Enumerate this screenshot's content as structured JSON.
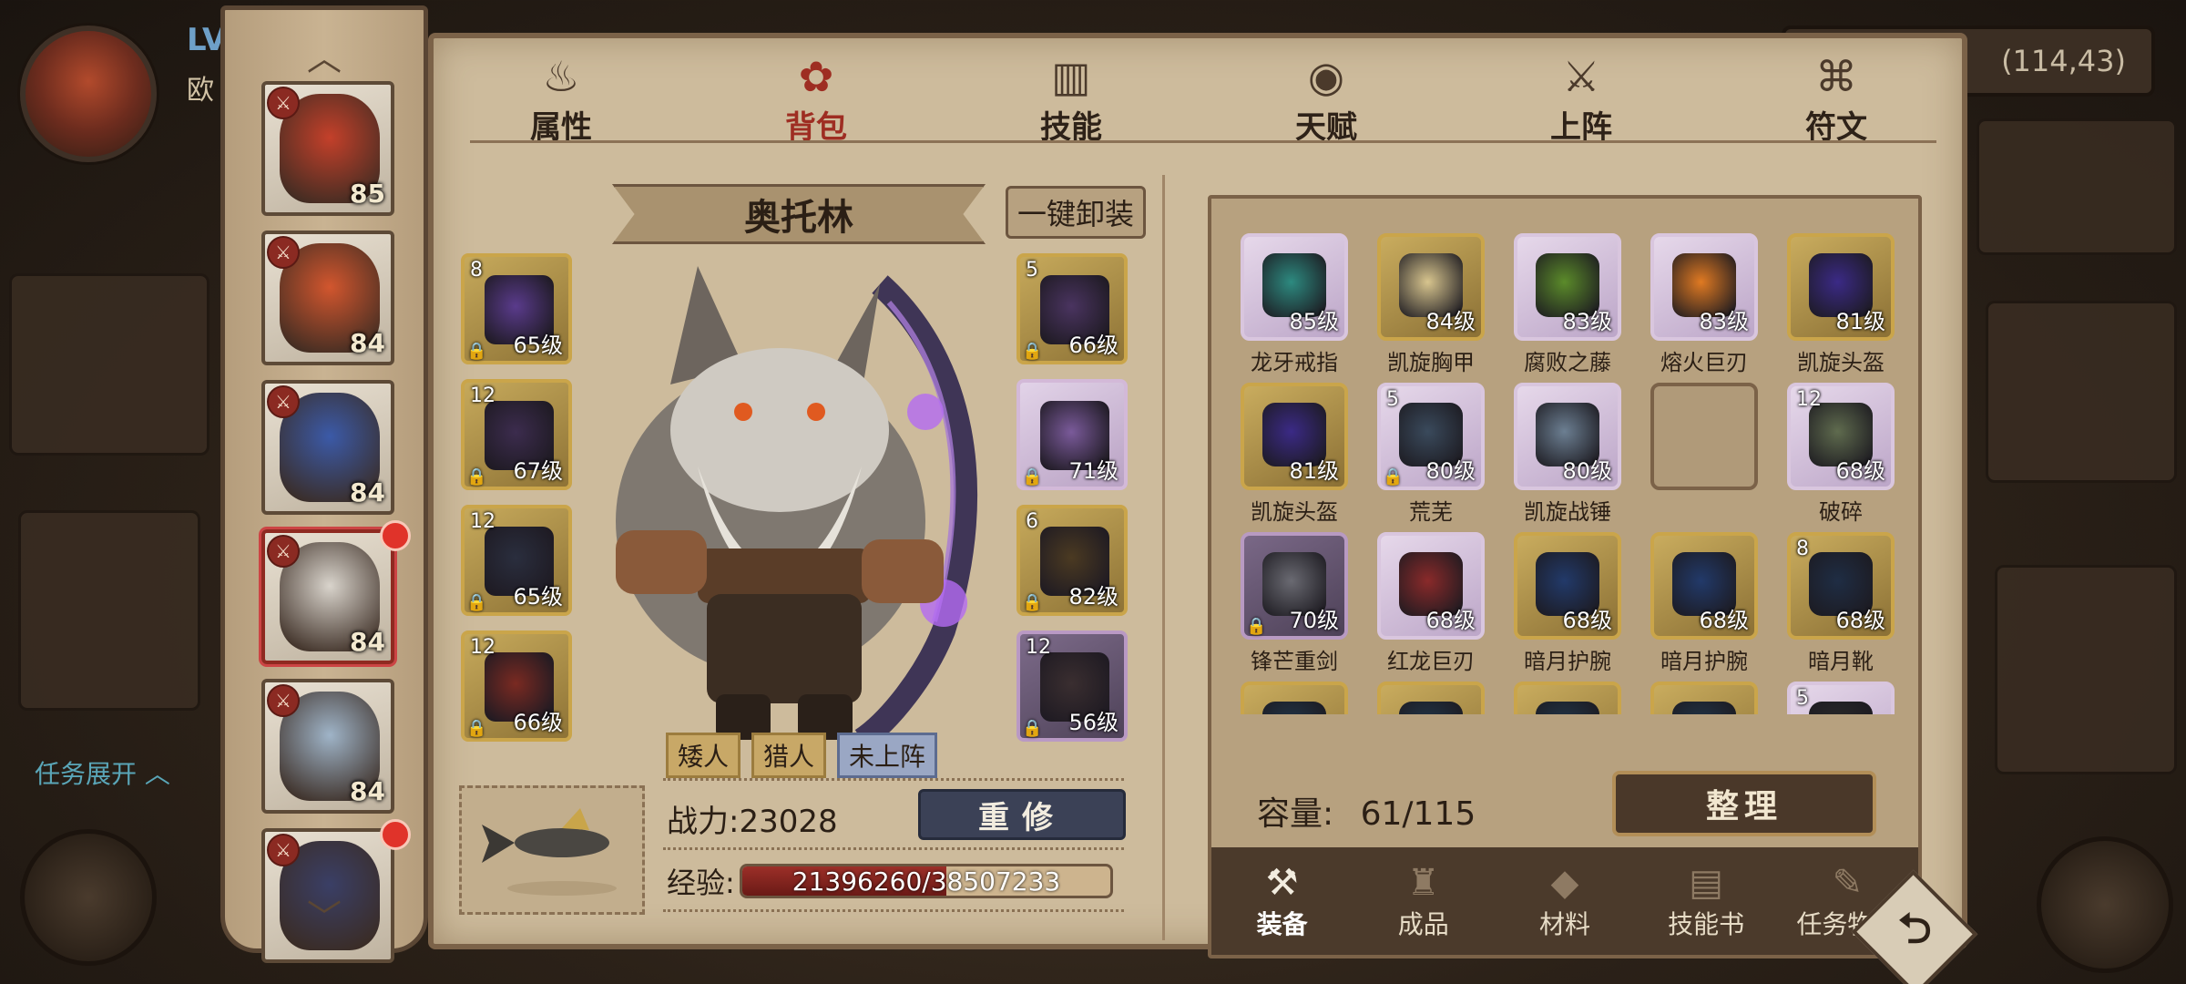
{
  "hud": {
    "level_prefix": "LV",
    "name_fragment": "欧",
    "coordinates": "(114,43)",
    "quest_toggle": "任务展开"
  },
  "roster": {
    "heroes": [
      {
        "level": "85",
        "accent": "#c4402a",
        "active": false,
        "red_dot": false
      },
      {
        "level": "84",
        "accent": "#d2562e",
        "active": false,
        "red_dot": false
      },
      {
        "level": "84",
        "accent": "#3b5aa8",
        "active": false,
        "red_dot": false
      },
      {
        "level": "84",
        "accent": "#d9d4cc",
        "active": true,
        "red_dot": true
      },
      {
        "level": "84",
        "accent": "#9fb4c8",
        "active": false,
        "red_dot": false
      },
      {
        "level": "",
        "accent": "#3a3f66",
        "active": false,
        "red_dot": true
      }
    ]
  },
  "tabs": [
    {
      "label": "属性",
      "icon": "flame-icon",
      "glyph": "♨",
      "active": false
    },
    {
      "label": "背包",
      "icon": "backpack-icon",
      "glyph": "✿",
      "active": true
    },
    {
      "label": "技能",
      "icon": "book-icon",
      "glyph": "▥",
      "active": false
    },
    {
      "label": "天赋",
      "icon": "eye-icon",
      "glyph": "◉",
      "active": false
    },
    {
      "label": "上阵",
      "icon": "crossed-swords-icon",
      "glyph": "⚔",
      "active": false
    },
    {
      "label": "符文",
      "icon": "rune-icon",
      "glyph": "⌘",
      "active": false
    }
  ],
  "hero": {
    "name": "奥托林",
    "unequip_all": "一键卸装",
    "tags": [
      "矮人",
      "猎人",
      "未上阵"
    ],
    "power": "战力:23028",
    "reforge": "重修",
    "exp_label": "经验:",
    "exp_text": "21396260/38507233",
    "exp_fraction": 0.5556
  },
  "equipment_left": [
    {
      "count": "8",
      "level": "65级",
      "rarity": "gold",
      "color": "#5a3b8c"
    },
    {
      "count": "12",
      "level": "67级",
      "rarity": "gold",
      "color": "#3c2c4e"
    },
    {
      "count": "12",
      "level": "65级",
      "rarity": "gold",
      "color": "#2a2e3e"
    },
    {
      "count": "12",
      "level": "66级",
      "rarity": "gold",
      "color": "#7a2a22"
    }
  ],
  "equipment_right": [
    {
      "count": "5",
      "level": "66级",
      "rarity": "gold",
      "color": "#4a3460"
    },
    {
      "count": "",
      "level": "71级",
      "rarity": "purple",
      "color": "#7a5a9a"
    },
    {
      "count": "6",
      "level": "82级",
      "rarity": "gold",
      "color": "#4b3a22"
    },
    {
      "count": "12",
      "level": "56级",
      "rarity": "dark",
      "color": "#3a2e30"
    }
  ],
  "inventory": {
    "capacity_label": "容量:",
    "capacity_value": "61/115",
    "sort_label": "整理",
    "items": [
      {
        "name": "龙牙戒指",
        "level": "85级",
        "count": "",
        "rarity": "purple",
        "color": "#2d8a80"
      },
      {
        "name": "凯旋胸甲",
        "level": "84级",
        "count": "",
        "rarity": "gold",
        "color": "#d8c58e"
      },
      {
        "name": "腐败之藤",
        "level": "83级",
        "count": "",
        "rarity": "purple",
        "color": "#5b8b2a"
      },
      {
        "name": "熔火巨刃",
        "level": "83级",
        "count": "",
        "rarity": "purple",
        "color": "#e07a22"
      },
      {
        "name": "凯旋头盔",
        "level": "81级",
        "count": "",
        "rarity": "gold",
        "color": "#3b2a86"
      },
      {
        "name": "凯旋头盔",
        "level": "81级",
        "count": "",
        "rarity": "gold",
        "color": "#3b2a86"
      },
      {
        "name": "荒芜",
        "level": "80级",
        "count": "5",
        "rarity": "purple",
        "color": "#3a4a5c"
      },
      {
        "name": "凯旋战锤",
        "level": "80级",
        "count": "",
        "rarity": "purple",
        "color": "#6c7f92"
      },
      {
        "name": "",
        "level": "",
        "count": "",
        "rarity": "empty",
        "color": "#b09a79"
      },
      {
        "name": "破碎",
        "level": "68级",
        "count": "12",
        "rarity": "purple",
        "color": "#5f6b4e"
      },
      {
        "name": "锋芒重剑",
        "level": "70级",
        "count": "",
        "rarity": "dark",
        "color": "#6a6a72"
      },
      {
        "name": "红龙巨刃",
        "level": "68级",
        "count": "",
        "rarity": "purple",
        "color": "#8a2a2a"
      },
      {
        "name": "暗月护腕",
        "level": "68级",
        "count": "",
        "rarity": "gold",
        "color": "#223a6a"
      },
      {
        "name": "暗月护腕",
        "level": "68级",
        "count": "",
        "rarity": "gold",
        "color": "#223a6a"
      },
      {
        "name": "暗月靴",
        "level": "68级",
        "count": "8",
        "rarity": "gold",
        "color": "#1f2d44"
      },
      {
        "name": "",
        "level": "",
        "count": "",
        "rarity": "gold",
        "color": "#22394e"
      },
      {
        "name": "",
        "level": "",
        "count": "",
        "rarity": "gold",
        "color": "#22394e"
      },
      {
        "name": "",
        "level": "",
        "count": "",
        "rarity": "gold",
        "color": "#22394e"
      },
      {
        "name": "",
        "level": "",
        "count": "",
        "rarity": "gold",
        "color": "#22394e"
      },
      {
        "name": "",
        "level": "",
        "count": "5",
        "rarity": "purple",
        "color": "#2b2b2b"
      }
    ],
    "tabs": [
      {
        "label": "装备",
        "icon": "hammer-icon",
        "glyph": "⚒",
        "active": true
      },
      {
        "label": "成品",
        "icon": "bag-icon",
        "glyph": "♜",
        "active": false
      },
      {
        "label": "材料",
        "icon": "ingot-icon",
        "glyph": "◆",
        "active": false
      },
      {
        "label": "技能书",
        "icon": "scroll-icon",
        "glyph": "▤",
        "active": false
      },
      {
        "label": "任务物品",
        "icon": "quest-scroll-icon",
        "glyph": "✎",
        "active": false
      }
    ]
  },
  "back_glyph": "⮌"
}
